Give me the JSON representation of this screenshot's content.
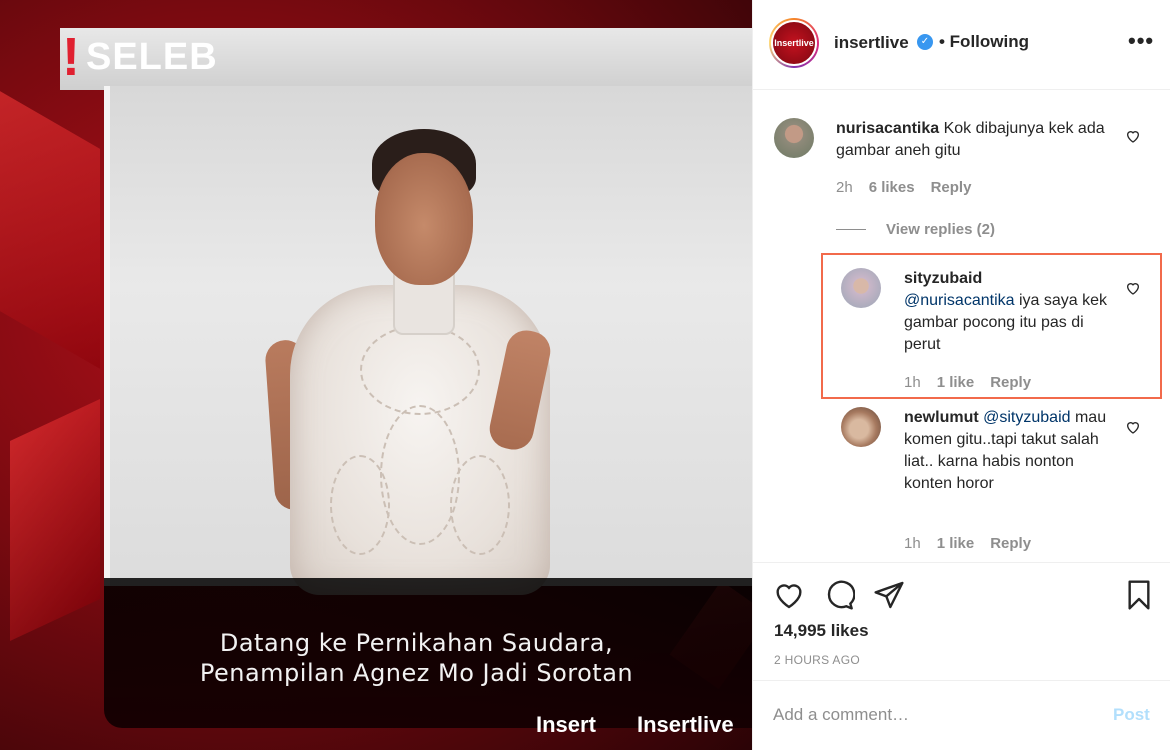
{
  "post_image": {
    "brand_tag": "SELEB",
    "caption_line1": "Datang ke Pernikahan Saudara,",
    "caption_line2": "Penampilan Agnez Mo Jadi Sorotan",
    "logo_insert": "Insert",
    "logo_insertlive": "Insertlive"
  },
  "header": {
    "avatar_text": "Insertlive",
    "username": "insertlive",
    "follow_status": "• Following",
    "more": "•••"
  },
  "comments": [
    {
      "username": "nurisacantika",
      "text": "Kok dibajunya kek ada gambar aneh gitu",
      "time": "2h",
      "likes": "6 likes",
      "reply": "Reply"
    }
  ],
  "view_replies": "View replies (2)",
  "replies": [
    {
      "username": "sityzubaid",
      "mention": "@nurisacantika",
      "text": " iya saya kek gambar pocong itu pas di perut",
      "time": "1h",
      "likes": "1 like",
      "reply": "Reply"
    },
    {
      "username": "newlumut",
      "mention": "@sityzubaid",
      "text": "mau komen gitu..tapi takut salah liat.. karna habis nonton konten horor",
      "time": "1h",
      "likes": "1 like",
      "reply": "Reply"
    }
  ],
  "actions": {
    "likes": "14,995 likes",
    "timestamp": "2 HOURS AGO"
  },
  "add_comment": {
    "placeholder": "Add a comment…",
    "post_label": "Post"
  },
  "colors": {
    "verified": "#3897f0",
    "mention": "#003569",
    "highlight_border": "#f26a4b",
    "post_disabled": "#b2dffc"
  }
}
